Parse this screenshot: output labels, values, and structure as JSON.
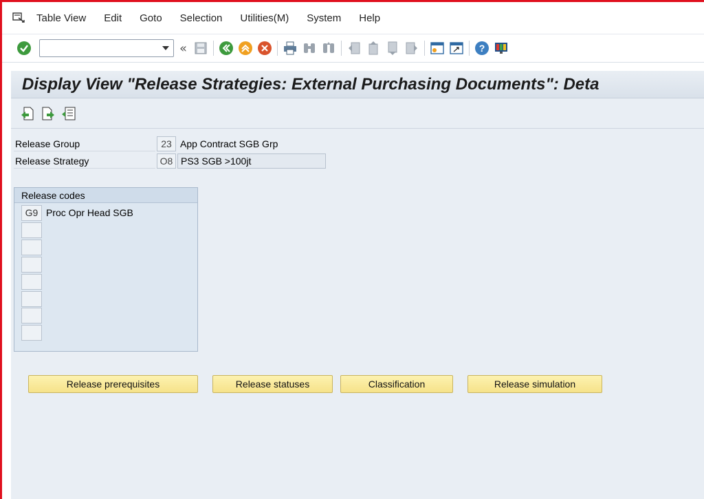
{
  "menubar": {
    "items": [
      {
        "label": "Table View"
      },
      {
        "label": "Edit"
      },
      {
        "label": "Goto"
      },
      {
        "label": "Selection"
      },
      {
        "label": "Utilities(M)"
      },
      {
        "label": "System"
      },
      {
        "label": "Help"
      }
    ]
  },
  "toolbar": {
    "command_field_value": "",
    "icons": [
      "enter-check-icon",
      "save-icon",
      "back-icon",
      "exit-icon",
      "cancel-icon",
      "print-icon",
      "find-icon",
      "find-next-icon",
      "first-page-icon",
      "previous-page-icon",
      "next-page-icon",
      "last-page-icon",
      "create-session-icon",
      "shortcut-icon",
      "help-icon",
      "customize-layout-icon"
    ]
  },
  "title": "Display View \"Release Strategies: External Purchasing Documents\": Deta",
  "fields": {
    "release_group": {
      "label": "Release Group",
      "code": "23",
      "description": "App Contract SGB Grp"
    },
    "release_strategy": {
      "label": "Release Strategy",
      "code": "O8",
      "description": "PS3 SGB >100jt"
    }
  },
  "release_codes": {
    "heading": "Release codes",
    "rows": [
      {
        "code": "G9",
        "description": "Proc Opr Head SGB"
      },
      {
        "code": "",
        "description": ""
      },
      {
        "code": "",
        "description": ""
      },
      {
        "code": "",
        "description": ""
      },
      {
        "code": "",
        "description": ""
      },
      {
        "code": "",
        "description": ""
      },
      {
        "code": "",
        "description": ""
      },
      {
        "code": "",
        "description": ""
      }
    ]
  },
  "buttons": {
    "prerequisites": "Release prerequisites",
    "statuses": "Release statuses",
    "classification": "Classification",
    "simulation": "Release simulation"
  },
  "colors": {
    "frame_red": "#e0101e",
    "background": "#e9eef4",
    "button_yellow": "#f6e28a"
  }
}
